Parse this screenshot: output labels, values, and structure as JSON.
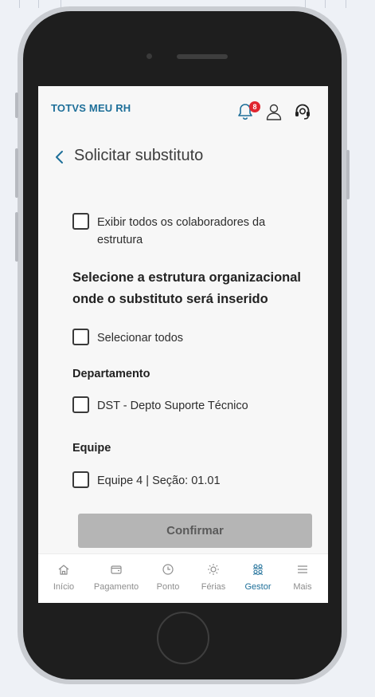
{
  "app": {
    "title": "TOTVS MEU RH",
    "notification_count": "8"
  },
  "page": {
    "title": "Solicitar substituto"
  },
  "options": {
    "show_all_label": "Exibir todos os colaboradores da estrutura",
    "section_title": "Selecione a estrutura organizacional onde o substituto será inserido",
    "select_all_label": "Selecionar todos",
    "department_title": "Departamento",
    "department_item": "DST - Depto Suporte Técnico",
    "team_title": "Equipe",
    "team_item": "Equipe 4 | Seção: 01.01"
  },
  "actions": {
    "confirm_label": "Confirmar"
  },
  "tabs": [
    {
      "label": "Início",
      "icon": "home-icon"
    },
    {
      "label": "Pagamento",
      "icon": "wallet-icon"
    },
    {
      "label": "Ponto",
      "icon": "clock-icon"
    },
    {
      "label": "Férias",
      "icon": "sun-icon"
    },
    {
      "label": "Gestor",
      "icon": "team-icon",
      "active": true
    },
    {
      "label": "Mais",
      "icon": "menu-icon"
    }
  ],
  "colors": {
    "brand": "#1e6f99",
    "badge": "#e0262f",
    "button_disabled": "#b5b5b5"
  }
}
